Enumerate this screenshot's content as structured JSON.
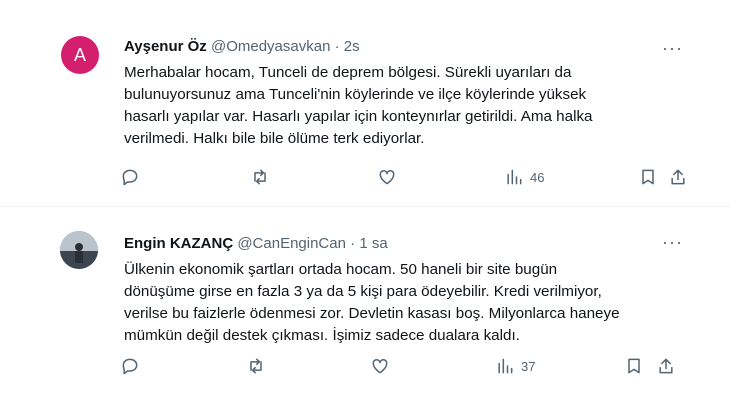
{
  "tweets": [
    {
      "avatar_letter": "A",
      "avatar_color": "#d41e6e",
      "name": "Ayşenur Öz",
      "handle": "@Omedyasavkan",
      "separator": "·",
      "time": "2s",
      "text_lines": [
        "Merhabalar hocam, Tunceli  de deprem bölgesi. Sürekli uyarıları da",
        "bulunuyorsunuz  ama Tunceli'nin köylerinde ve ilçe köylerinde  yüksek",
        "hasarlı yapılar var. Hasarlı yapılar için konteynırlar getirildi.  Ama halka",
        "verilmedi. Halkı bile bile ölüme terk ediyorlar."
      ],
      "views": "46"
    },
    {
      "avatar_letter": "",
      "avatar_color": "#8a9aa8",
      "name": "Engin KAZANÇ",
      "handle": "@CanEnginCan",
      "separator": "·",
      "time": "1 sa",
      "text_lines": [
        "Ülkenin ekonomik şartları ortada hocam. 50 haneli bir site bugün",
        "dönüşüme girse en fazla 3 ya da 5 kişi para ödeyebilir. Kredi verilmiyor,",
        "verilse bu faizlerle ödenmesi zor. Devletin kasası boş. Milyonlarca haneye",
        "mümkün değil destek çıkması. İşimiz sadece dualara kaldı."
      ],
      "views": "37"
    }
  ],
  "more_glyph": "···",
  "colors": {
    "text": "#0f1419",
    "muted": "#536471",
    "divider": "#eff3f4"
  },
  "icons": [
    "reply-icon",
    "retweet-icon",
    "like-icon",
    "views-icon",
    "bookmark-icon",
    "share-icon",
    "more-icon"
  ]
}
